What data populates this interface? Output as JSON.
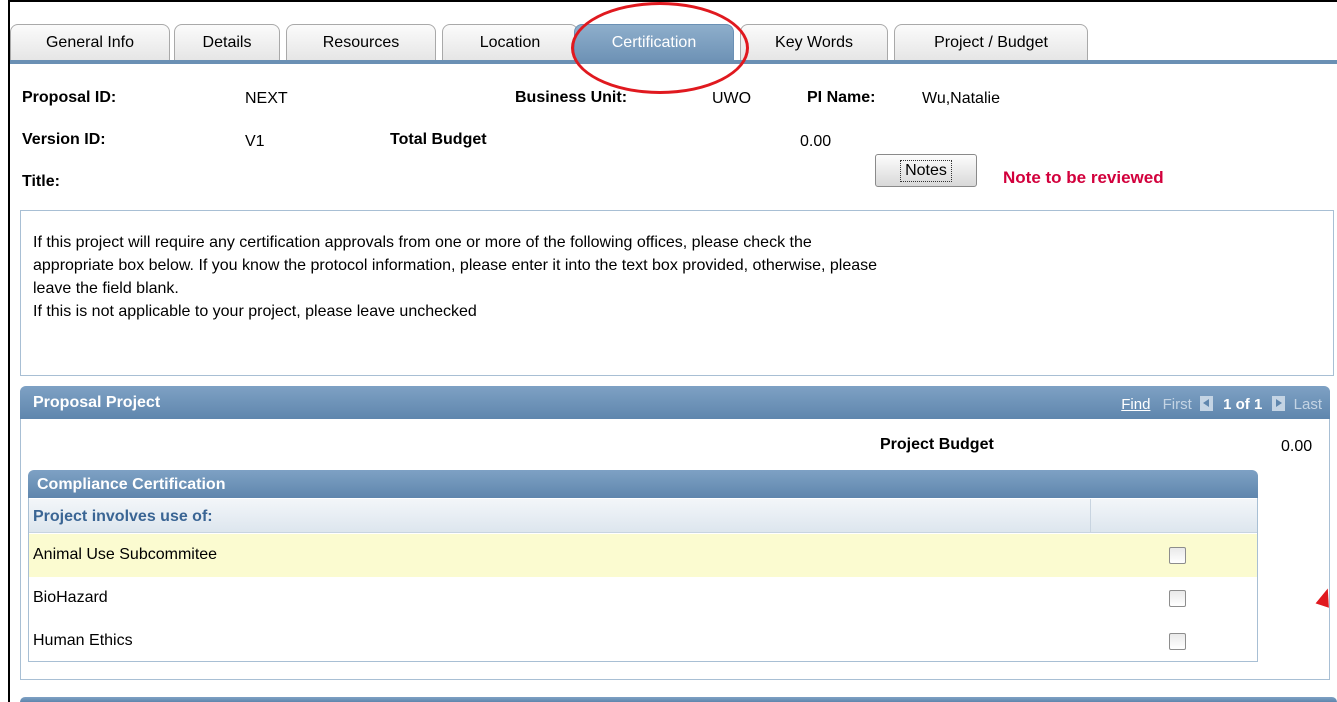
{
  "tabs": [
    {
      "label": "General Info",
      "active": false
    },
    {
      "label": "Details",
      "active": false
    },
    {
      "label": "Resources",
      "active": false
    },
    {
      "label": "Location",
      "active": false
    },
    {
      "label": "Certification",
      "active": true
    },
    {
      "label": "Key Words",
      "active": false
    },
    {
      "label": "Project / Budget",
      "active": false
    }
  ],
  "header": {
    "proposal_id_label": "Proposal ID:",
    "proposal_id": "NEXT",
    "business_unit_label": "Business Unit:",
    "business_unit": "UWO",
    "pi_name_label": "PI Name:",
    "pi_name": "Wu,Natalie",
    "version_id_label": "Version ID:",
    "version_id": "V1",
    "total_budget_label": "Total Budget",
    "total_budget": "0.00",
    "title_label": "Title:",
    "notes_button": "Notes",
    "note_status": "Note to be reviewed"
  },
  "instructions": {
    "line1": "If this project will require any certification approvals from one or more of the following offices, please check the",
    "line2": "appropriate box below. If you know the protocol information, please enter it into the text box provided, otherwise, please",
    "line3": "leave the field blank.",
    "line4": "If this is not applicable to your project, please leave unchecked"
  },
  "proposal_project": {
    "title": "Proposal Project",
    "nav": {
      "find": "Find",
      "first": "First",
      "count": "1 of 1",
      "last": "Last"
    },
    "project_budget_label": "Project Budget",
    "project_budget": "0.00",
    "compliance": {
      "title": "Compliance Certification",
      "column_header": "Project involves use of:",
      "rows": [
        {
          "label": "Animal Use Subcommitee",
          "checked": false
        },
        {
          "label": "BioHazard",
          "checked": false
        },
        {
          "label": "Human Ethics",
          "checked": false
        }
      ]
    }
  },
  "colors": {
    "accent": "#6b90b4",
    "highlight_circle": "#e0191f",
    "note_text": "#d2003c",
    "row_highlight": "#fbfbd0"
  }
}
